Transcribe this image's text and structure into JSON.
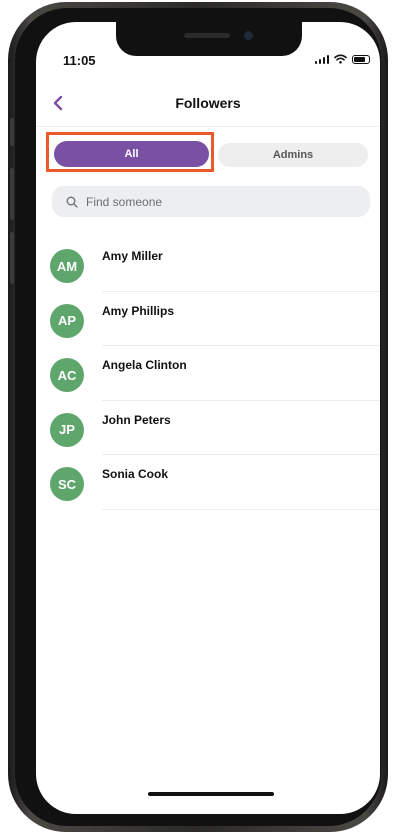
{
  "status_bar": {
    "time": "11:05"
  },
  "header": {
    "title": "Followers"
  },
  "tabs": [
    {
      "label": "All",
      "selected": true
    },
    {
      "label": "Admins",
      "selected": false
    }
  ],
  "search": {
    "placeholder": "Find someone",
    "value": ""
  },
  "followers": [
    {
      "initials": "AM",
      "name": "Amy Miller"
    },
    {
      "initials": "AP",
      "name": "Amy Phillips"
    },
    {
      "initials": "AC",
      "name": "Angela Clinton"
    },
    {
      "initials": "JP",
      "name": "John Peters"
    },
    {
      "initials": "SC",
      "name": "Sonia Cook"
    }
  ],
  "colors": {
    "accent": "#7a50a5",
    "avatar": "#5fa66d",
    "highlight": "#ec5a2c"
  },
  "icons": [
    "back-chevron-icon",
    "search-icon",
    "signal-icon",
    "wifi-icon",
    "battery-icon"
  ]
}
